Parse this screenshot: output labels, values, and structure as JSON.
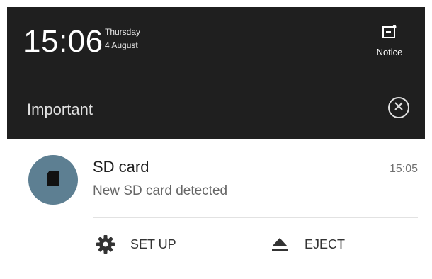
{
  "status": {
    "time": "15:06",
    "weekday": "Thursday",
    "date": "4 August",
    "notice_label": "Notice"
  },
  "section": {
    "title": "Important"
  },
  "notification": {
    "title": "SD card",
    "time": "15:05",
    "body": "New SD card detected",
    "avatar_icon": "sd-card-icon",
    "avatar_color": "#5d7f92",
    "actions": [
      {
        "label": "SET UP",
        "icon": "gear-icon"
      },
      {
        "label": "EJECT",
        "icon": "eject-icon"
      }
    ]
  },
  "colors": {
    "background": "#1f1f1f",
    "card": "#ffffff"
  }
}
